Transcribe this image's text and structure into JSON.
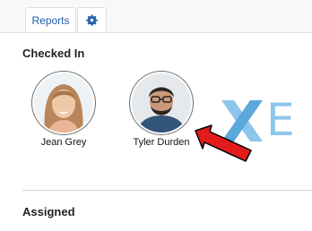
{
  "tabs": [
    {
      "label": "Reports",
      "active": true
    },
    {
      "icon": "gear-icon"
    }
  ],
  "sections": {
    "checked_in": {
      "title": "Checked In",
      "people": [
        {
          "name": "Jean Grey"
        },
        {
          "name": "Tyler Durden"
        }
      ]
    },
    "assigned": {
      "title": "Assigned"
    }
  },
  "watermark": {
    "text": "E"
  },
  "colors": {
    "accent": "#1f5fa8",
    "arrow": "#e31b1b",
    "watermark": "#8ec5ea"
  }
}
